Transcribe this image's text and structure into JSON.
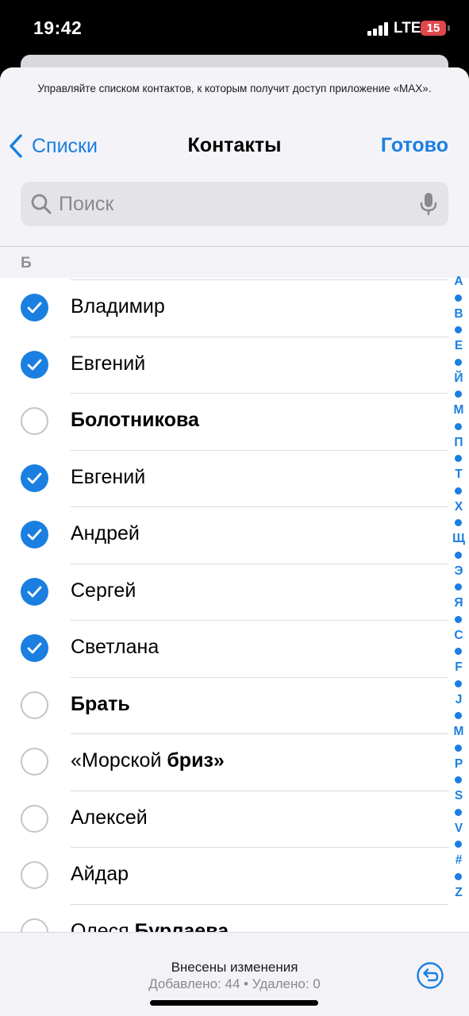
{
  "status_bar": {
    "time": "19:42",
    "network": "LTE",
    "battery": "15"
  },
  "privacy_note": "Управляйте списком контактов, к которым получит доступ приложение «MAX».",
  "nav": {
    "back_label": "Списки",
    "title": "Контакты",
    "done_label": "Готово"
  },
  "search": {
    "placeholder": "Поиск"
  },
  "section": {
    "letter": "Б"
  },
  "contacts": [
    {
      "first": "Владимир",
      "last": "",
      "checked": true
    },
    {
      "first": "Евгений",
      "last": "",
      "checked": true
    },
    {
      "first": "",
      "last": "Болотникова",
      "checked": false
    },
    {
      "first": "Евгений",
      "last": "",
      "checked": true
    },
    {
      "first": "Андрей",
      "last": "",
      "checked": true
    },
    {
      "first": "Сергей",
      "last": "",
      "checked": true
    },
    {
      "first": "Светлана",
      "last": "",
      "checked": true
    },
    {
      "first": "",
      "last": "Брать",
      "checked": false
    },
    {
      "first": "«Морской",
      "last": "бриз»",
      "checked": false
    },
    {
      "first": "Алексей",
      "last": "",
      "checked": false
    },
    {
      "first": "Айдар",
      "last": "",
      "checked": false
    },
    {
      "first": "Олеся",
      "last": "Бурлаева",
      "checked": false
    }
  ],
  "index_letters": [
    "А",
    "В",
    "Е",
    "Й",
    "М",
    "П",
    "Т",
    "Х",
    "Щ",
    "Э",
    "Я",
    "C",
    "F",
    "J",
    "M",
    "P",
    "S",
    "V",
    "#",
    "Z"
  ],
  "toolbar": {
    "changes_title": "Внесены изменения",
    "changes_stats": "Добавлено: 44 • Удалено: 0"
  },
  "colors": {
    "accent": "#1a7fe0",
    "battery": "#e0484c"
  }
}
